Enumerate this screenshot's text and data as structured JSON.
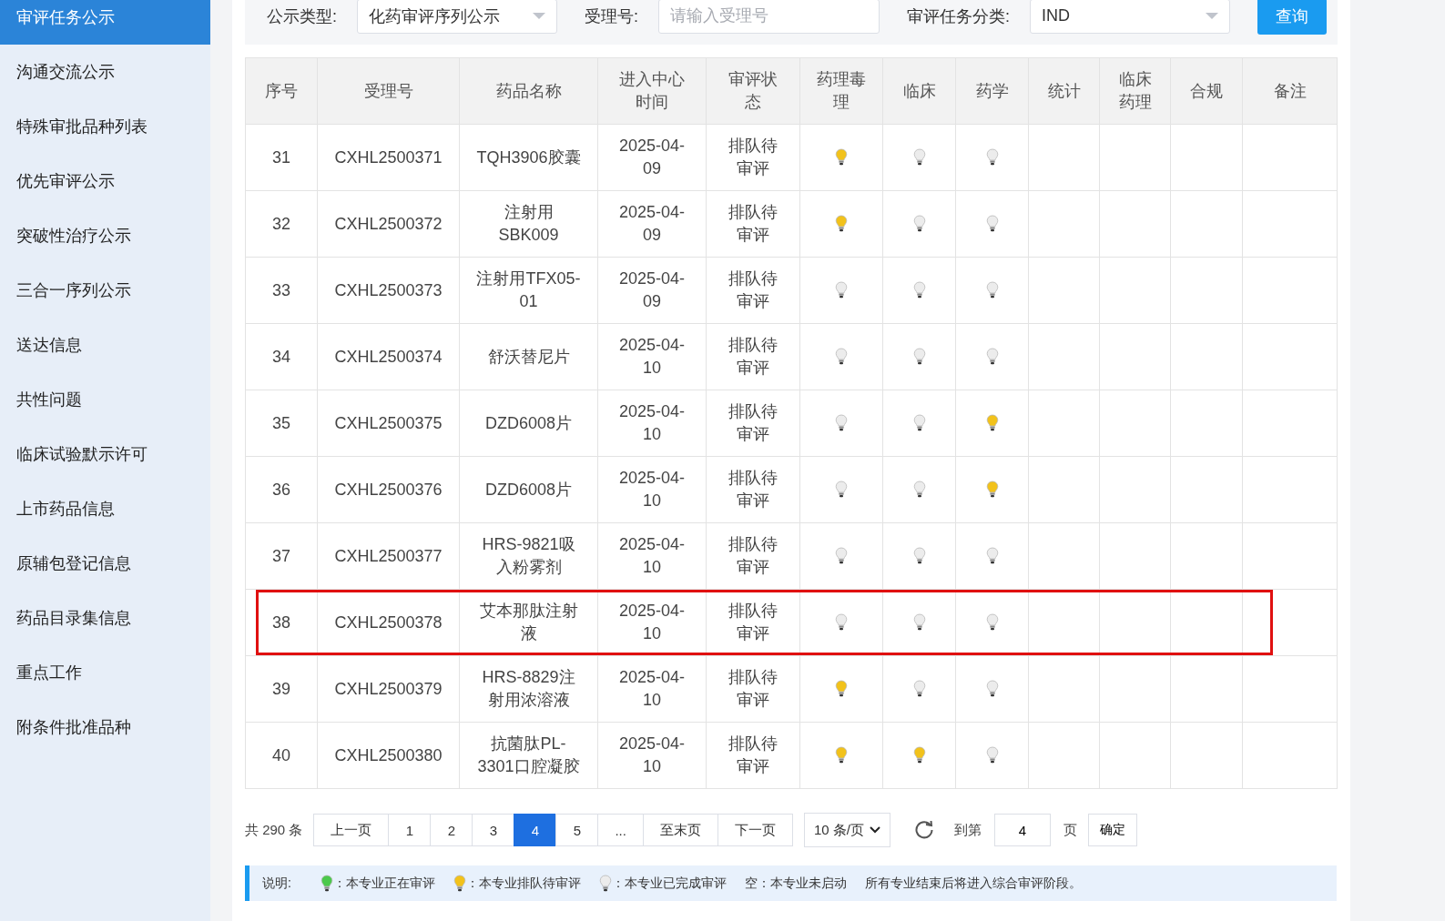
{
  "sidebar": {
    "items": [
      {
        "label": "审评任务公示",
        "selected": true
      },
      {
        "label": "沟通交流公示",
        "selected": false
      },
      {
        "label": "特殊审批品种列表",
        "selected": false
      },
      {
        "label": "优先审评公示",
        "selected": false
      },
      {
        "label": "突破性治疗公示",
        "selected": false
      },
      {
        "label": "三合一序列公示",
        "selected": false
      },
      {
        "label": "送达信息",
        "selected": false
      },
      {
        "label": "共性问题",
        "selected": false
      },
      {
        "label": "临床试验默示许可",
        "selected": false
      },
      {
        "label": "上市药品信息",
        "selected": false
      },
      {
        "label": "原辅包登记信息",
        "selected": false
      },
      {
        "label": "药品目录集信息",
        "selected": false
      },
      {
        "label": "重点工作",
        "selected": false
      },
      {
        "label": "附条件批准品种",
        "selected": false
      }
    ]
  },
  "filters": [
    {
      "label": "公示类型:",
      "kind": "select",
      "value": "化药审评序列公示"
    },
    {
      "label": "受理号:",
      "kind": "input",
      "placeholder": "请输入受理号"
    },
    {
      "label": "审评任务分类:",
      "kind": "select",
      "value": "IND"
    }
  ],
  "search_button": "查询",
  "table": {
    "columns": [
      "序号",
      "受理号",
      "药品名称",
      "进入中心时间",
      "审评状态",
      "药理毒理",
      "临床",
      "药学",
      "统计",
      "临床药理",
      "合规",
      "备注"
    ],
    "rows": [
      {
        "cells": [
          "31",
          "CXHL2500371",
          "TQH3906胶囊",
          "2025-04-09",
          "排队待审评"
        ],
        "bulbs": [
          {
            "color": "#f2c21b"
          },
          {
            "color": "#ececec"
          },
          {
            "color": "#ececec"
          }
        ],
        "highlighted": false
      },
      {
        "cells": [
          "32",
          "CXHL2500372",
          "注射用SBK009",
          "2025-04-09",
          "排队待审评"
        ],
        "bulbs": [
          {
            "color": "#f2c21b"
          },
          {
            "color": "#ececec"
          },
          {
            "color": "#ececec"
          }
        ],
        "highlighted": false
      },
      {
        "cells": [
          "33",
          "CXHL2500373",
          "注射用TFX05-01",
          "2025-04-09",
          "排队待审评"
        ],
        "bulbs": [
          {
            "color": "#ececec"
          },
          {
            "color": "#ececec"
          },
          {
            "color": "#ececec"
          }
        ],
        "highlighted": false
      },
      {
        "cells": [
          "34",
          "CXHL2500374",
          "舒沃替尼片",
          "2025-04-10",
          "排队待审评"
        ],
        "bulbs": [
          {
            "color": "#ececec"
          },
          {
            "color": "#ececec"
          },
          {
            "color": "#ececec"
          }
        ],
        "highlighted": false
      },
      {
        "cells": [
          "35",
          "CXHL2500375",
          "DZD6008片",
          "2025-04-10",
          "排队待审评"
        ],
        "bulbs": [
          {
            "color": "#ececec"
          },
          {
            "color": "#ececec"
          },
          {
            "color": "#f2c21b"
          }
        ],
        "highlighted": false
      },
      {
        "cells": [
          "36",
          "CXHL2500376",
          "DZD6008片",
          "2025-04-10",
          "排队待审评"
        ],
        "bulbs": [
          {
            "color": "#ececec"
          },
          {
            "color": "#ececec"
          },
          {
            "color": "#f2c21b"
          }
        ],
        "highlighted": false
      },
      {
        "cells": [
          "37",
          "CXHL2500377",
          "HRS-9821吸入粉雾剂",
          "2025-04-10",
          "排队待审评"
        ],
        "bulbs": [
          {
            "color": "#ececec"
          },
          {
            "color": "#ececec"
          },
          {
            "color": "#ececec"
          }
        ],
        "highlighted": false
      },
      {
        "cells": [
          "38",
          "CXHL2500378",
          "艾本那肽注射液",
          "2025-04-10",
          "排队待审评"
        ],
        "bulbs": [
          {
            "color": "#ececec"
          },
          {
            "color": "#ececec"
          },
          {
            "color": "#ececec"
          }
        ],
        "highlighted": true
      },
      {
        "cells": [
          "39",
          "CXHL2500379",
          "HRS-8829注射用浓溶液",
          "2025-04-10",
          "排队待审评"
        ],
        "bulbs": [
          {
            "color": "#f2c21b"
          },
          {
            "color": "#ececec"
          },
          {
            "color": "#ececec"
          }
        ],
        "highlighted": false
      },
      {
        "cells": [
          "40",
          "CXHL2500380",
          "抗菌肽PL-3301口腔凝胶",
          "2025-04-10",
          "排队待审评"
        ],
        "bulbs": [
          {
            "color": "#f2c21b"
          },
          {
            "color": "#f2c21b"
          },
          {
            "color": "#ececec"
          }
        ],
        "highlighted": false
      }
    ]
  },
  "pagination": {
    "total": "共 290 条",
    "pages": [
      {
        "label": "上一页",
        "selected": false
      },
      {
        "label": "1",
        "selected": false
      },
      {
        "label": "2",
        "selected": false
      },
      {
        "label": "3",
        "selected": false
      },
      {
        "label": "4",
        "selected": true
      },
      {
        "label": "5",
        "selected": false
      },
      {
        "label": "...",
        "selected": false
      },
      {
        "label": "至末页",
        "selected": false
      },
      {
        "label": "下一页",
        "selected": false
      }
    ],
    "page_size": "10 条/页",
    "goto_label": "到第",
    "goto_value": "4",
    "page_unit": "页",
    "confirm": "确定"
  },
  "legend": {
    "label": "说明:",
    "items": [
      {
        "color": "#4cc94c",
        "text": "：本专业正在审评"
      },
      {
        "color": "#f2c21b",
        "text": "：本专业排队待审评"
      },
      {
        "color": "#ececec",
        "text": "：本专业已完成审评"
      }
    ],
    "empty_note": "空：本专业未启动",
    "final_note": "所有专业结束后将进入综合审评阶段。"
  }
}
